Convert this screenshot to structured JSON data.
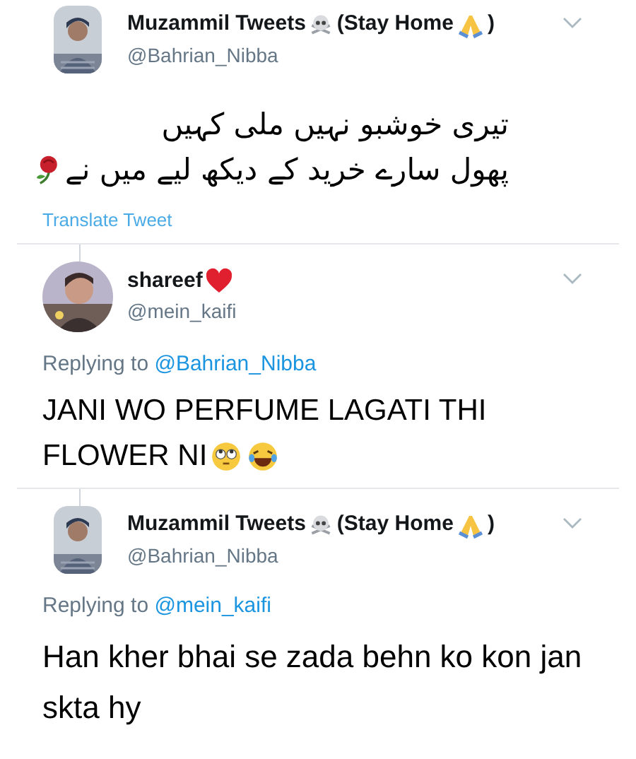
{
  "tweets": [
    {
      "avatar": {
        "kind": "picture",
        "round": false
      },
      "name": [
        {
          "kind": "text",
          "text": "Muzammil Tweets"
        },
        {
          "kind": "skull-emoji"
        },
        {
          "kind": "text",
          "text": "(Stay Home"
        },
        {
          "kind": "pray-emoji"
        },
        {
          "kind": "text",
          "text": ")"
        }
      ],
      "handle": "@Bahrian_Nibba",
      "body": {
        "kind": "rtl-text",
        "lines": [
          "تیری خوشبو نہیں ملی کہیں",
          "پھول سارے خرید کے دیکھ لیے میں نے"
        ],
        "emojis": [
          {
            "kind": "rose-emoji"
          }
        ]
      },
      "translate": "Translate Tweet"
    },
    {
      "avatar": {
        "kind": "picture",
        "round": true
      },
      "name": [
        {
          "kind": "text",
          "text": "shareef"
        },
        {
          "kind": "heart-emoji"
        }
      ],
      "handle": "@mein_kaifi",
      "replying": {
        "label": "Replying to",
        "handle": "@Bahrian_Nibba"
      },
      "body": {
        "kind": "text",
        "lines": [
          "JANI WO PERFUME LAGATI THI",
          "FLOWER NI"
        ],
        "emojis": [
          {
            "kind": "eyes-emoji"
          },
          {
            "kind": "laugh-emoji"
          }
        ]
      }
    },
    {
      "avatar": {
        "kind": "picture",
        "round": false
      },
      "name": [
        {
          "kind": "text",
          "text": "Muzammil Tweets"
        },
        {
          "kind": "skull-emoji"
        },
        {
          "kind": "text",
          "text": "(Stay Home"
        },
        {
          "kind": "pray-emoji"
        },
        {
          "kind": "text",
          "text": ")"
        }
      ],
      "handle": "@Bahrian_Nibba",
      "replying": {
        "label": "Replying to",
        "handle": "@mein_kaifi"
      },
      "body": {
        "kind": "text",
        "lines": [
          "Han kher bhai se zada behn ko kon jan",
          "skta hy"
        ]
      }
    }
  ]
}
